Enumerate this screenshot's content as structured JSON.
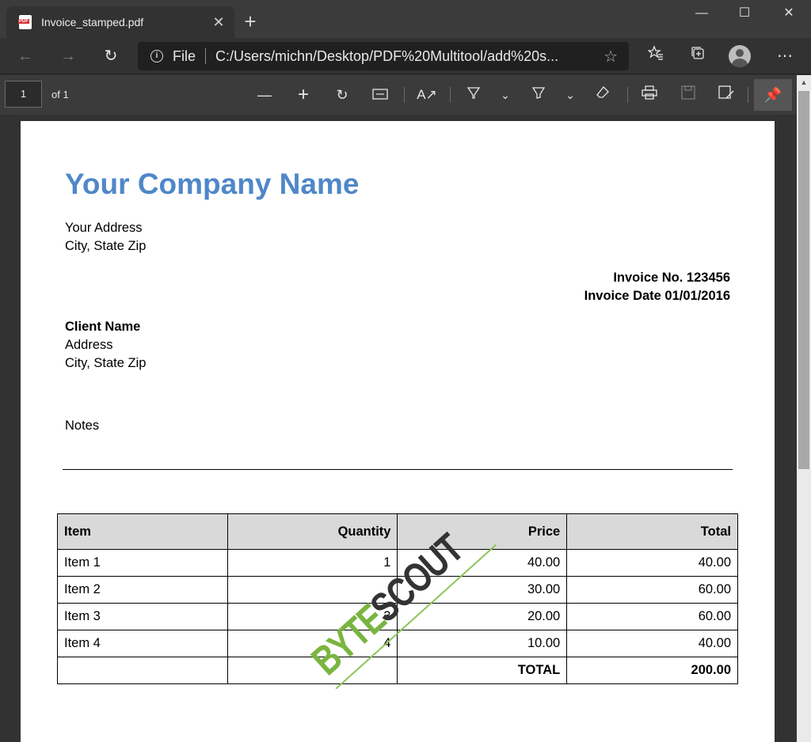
{
  "browser": {
    "tab": {
      "title": "Invoice_stamped.pdf"
    },
    "address": {
      "scheme": "File",
      "url": "C:/Users/michn/Desktop/PDF%20Multitool/add%20s..."
    }
  },
  "pdf_toolbar": {
    "page_number": "1",
    "page_of": "of 1"
  },
  "document": {
    "company_name": "Your Company Name",
    "address_line1": "Your Address",
    "address_line2": "City, State Zip",
    "invoice_no": "Invoice No. 123456",
    "invoice_date": "Invoice Date 01/01/2016",
    "client_name": "Client Name",
    "client_address1": "Address",
    "client_address2": "City, State Zip",
    "notes_label": "Notes",
    "table": {
      "headers": [
        "Item",
        "Quantity",
        "Price",
        "Total"
      ],
      "rows": [
        [
          "Item 1",
          "1",
          "40.00",
          "40.00"
        ],
        [
          "Item 2",
          "",
          "30.00",
          "60.00"
        ],
        [
          "Item 3",
          "3",
          "20.00",
          "60.00"
        ],
        [
          "Item 4",
          "4",
          "10.00",
          "40.00"
        ]
      ],
      "total_label": "TOTAL",
      "total_value": "200.00"
    },
    "stamp": {
      "part1": "BYTE",
      "part2": "SCOUT",
      "colors": {
        "part1": "#7ab540",
        "part2": "#333333"
      }
    }
  },
  "colors": {
    "company_name": "#4f87c9",
    "toolbar": "#3b3b3b",
    "page": "#ffffff"
  }
}
